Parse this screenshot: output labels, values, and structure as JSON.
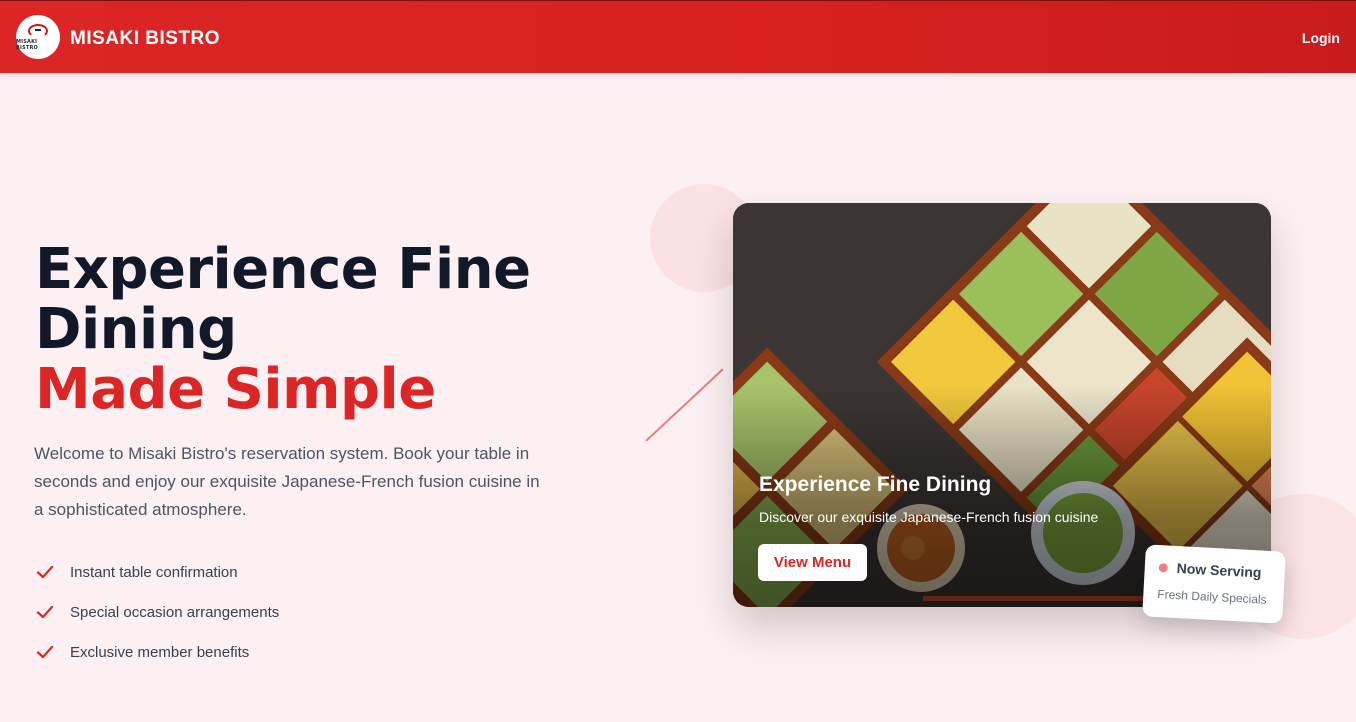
{
  "header": {
    "logo_text": "MISAKI BISTRO",
    "brand_name": "MISAKI BISTRO",
    "login_label": "Login"
  },
  "hero": {
    "title_line1": "Experience Fine Dining",
    "title_accent": "Made Simple",
    "description": "Welcome to Misaki Bistro's reservation system. Book your table in seconds and enjoy our exquisite Japanese-French fusion cuisine in a sophisticated atmosphere.",
    "features": [
      {
        "icon": "check-icon",
        "label": "Instant table confirmation"
      },
      {
        "icon": "check-icon",
        "label": "Special occasion arrangements"
      },
      {
        "icon": "check-icon",
        "label": "Exclusive member benefits"
      }
    ]
  },
  "card": {
    "title": "Experience Fine Dining",
    "subtitle": "Discover our exquisite Japanese-French fusion cuisine",
    "button_label": "View Menu"
  },
  "badge": {
    "title": "Now Serving",
    "subtitle": "Fresh Daily Specials"
  },
  "colors": {
    "primary": "#dc2626",
    "heading": "#111827",
    "page_bg": "#fdf0f3"
  }
}
